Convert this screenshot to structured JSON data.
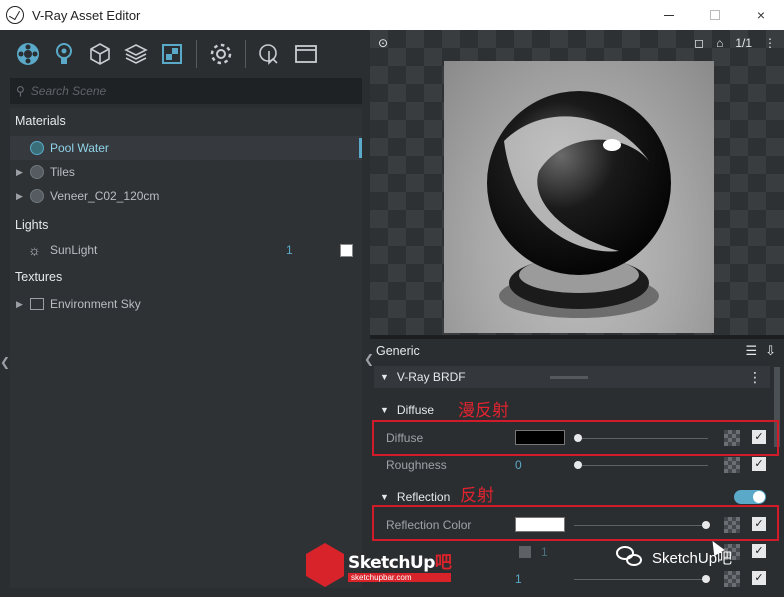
{
  "window": {
    "title": "V-Ray Asset Editor",
    "controls": {
      "minimize": "minimize",
      "maximize": "maximize",
      "close": "×"
    }
  },
  "toolbar": {
    "icons": [
      "materials-icon",
      "lights-icon",
      "geometry-icon",
      "render-elements-icon",
      "textures-icon",
      "settings-icon",
      "interactive-render-icon",
      "frame-buffer-icon"
    ]
  },
  "search": {
    "placeholder": "Search Scene"
  },
  "tree": {
    "materials_header": "Materials",
    "materials": [
      {
        "label": "Pool Water",
        "selected": true
      },
      {
        "label": "Tiles",
        "selected": false
      },
      {
        "label": "Veneer_C02_120cm",
        "selected": false
      }
    ],
    "lights_header": "Lights",
    "lights": [
      {
        "label": "SunLight",
        "count": "1",
        "color": "#ffffff"
      }
    ],
    "textures_header": "Textures",
    "textures": [
      {
        "label": "Environment Sky"
      }
    ]
  },
  "preview": {
    "toolbar_left": "⊙",
    "toolbar_right": [
      "◻",
      "⌂",
      "1/1",
      "⋮"
    ]
  },
  "properties": {
    "header": "Generic",
    "brdf": "V-Ray BRDF",
    "diffuse_section": "Diffuse",
    "diffuse": {
      "label": "Diffuse",
      "color": "#000000"
    },
    "roughness": {
      "label": "Roughness",
      "value": "0"
    },
    "reflection_section": "Reflection",
    "reflection_color": {
      "label": "Reflection Color",
      "color": "#ffffff"
    },
    "partial_rows": [
      {
        "value": "1"
      },
      {
        "value": "1"
      }
    ]
  },
  "annotations": {
    "diffuse_note": "漫反射",
    "reflection_note": "反射"
  },
  "watermarks": {
    "logo_text_main": "SketchUp",
    "logo_text_accent": "吧",
    "logo_sub": "sketchupbar.com",
    "channel": "SketchUp吧"
  },
  "colors": {
    "accent": "#5aa9c8",
    "annotation_red": "#d11a2a",
    "panel_bg": "#2b2e31"
  }
}
